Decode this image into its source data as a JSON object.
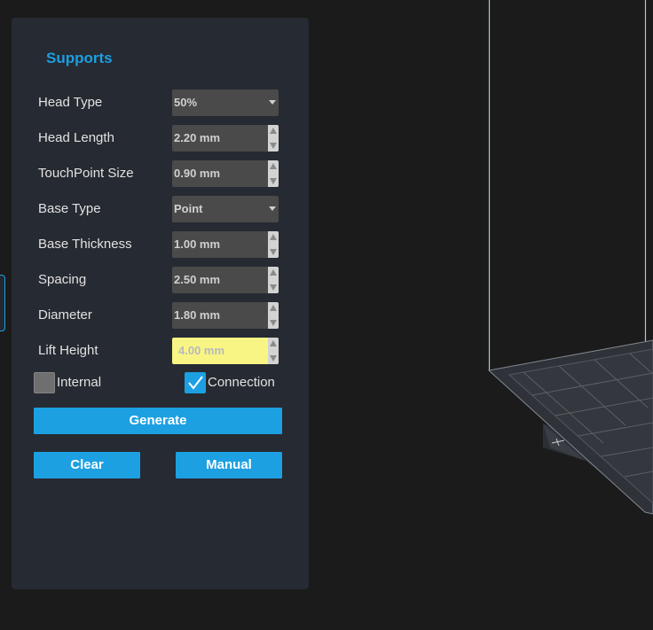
{
  "panel": {
    "title": "Supports",
    "fields": [
      {
        "label": "Head Type",
        "value": "50%",
        "control": "dropdown"
      },
      {
        "label": "Head Length",
        "value": "2.20 mm",
        "control": "spinner"
      },
      {
        "label": "TouchPoint Size",
        "value": "0.90 mm",
        "control": "spinner"
      },
      {
        "label": "Base Type",
        "value": "Point",
        "control": "dropdown"
      },
      {
        "label": "Base Thickness",
        "value": "1.00 mm",
        "control": "spinner"
      },
      {
        "label": "Spacing",
        "value": "2.50 mm",
        "control": "spinner"
      },
      {
        "label": "Diameter",
        "value": "1.80 mm",
        "control": "spinner"
      },
      {
        "label": "Lift Height",
        "value": "4.00 mm",
        "control": "spinner",
        "highlighted": true
      }
    ],
    "checkboxes": {
      "internal": {
        "label": "Internal",
        "checked": false
      },
      "connection": {
        "label": "Connection",
        "checked": true
      }
    },
    "buttons": {
      "generate": "Generate",
      "clear": "Clear",
      "manual": "Manual"
    }
  },
  "colors": {
    "accent": "#1da0e2",
    "panel_bg": "#262a32",
    "app_bg": "#1b1b1b",
    "highlight_field": "#f8f585"
  },
  "icons": {
    "dropdown": "chevron-down-icon",
    "spinner_up": "arrow-up-icon",
    "spinner_down": "arrow-down-icon",
    "check": "checkmark-icon"
  }
}
